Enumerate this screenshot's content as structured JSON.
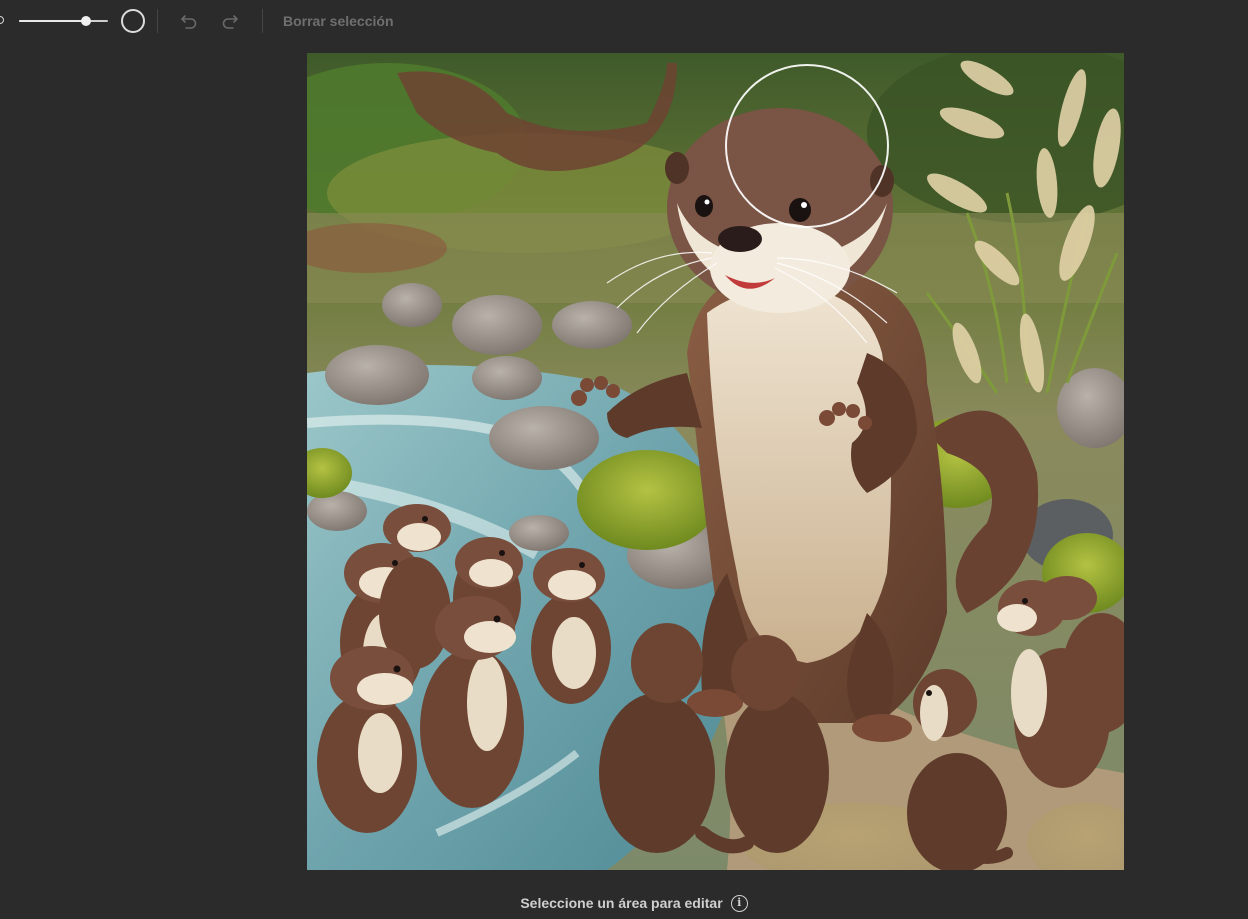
{
  "toolbar": {
    "brush_size_level": 0.75,
    "brush_small_icon": "circle-small-icon",
    "brush_large_icon": "circle-large-icon",
    "undo_icon": "undo-icon",
    "redo_icon": "redo-icon",
    "clear_selection_label": "Borrar selección"
  },
  "canvas": {
    "image_subject": "otters-scene",
    "cursor_icon": "brush-cursor-icon"
  },
  "footer": {
    "hint_text": "Seleccione un área para editar",
    "info_icon": "info-icon",
    "info_glyph": "i"
  },
  "colors": {
    "background": "#2b2b2b",
    "toolbar_text": "#6f6f6f",
    "hint_text": "#cfcfcf"
  }
}
